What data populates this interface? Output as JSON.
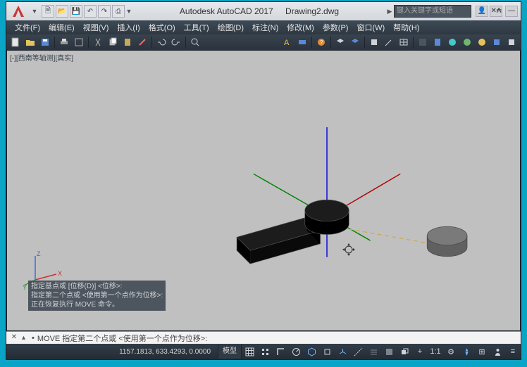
{
  "titlebar": {
    "app_name": "Autodesk AutoCAD 2017",
    "file_name": "Drawing2.dwg",
    "search_placeholder": "键入关键字或短语",
    "qat": [
      "new",
      "open",
      "save",
      "undo",
      "redo",
      "print"
    ]
  },
  "menu": {
    "file": "文件(F)",
    "edit": "编辑(E)",
    "view": "视图(V)",
    "insert": "插入(I)",
    "format": "格式(O)",
    "tools": "工具(T)",
    "draw": "绘图(D)",
    "dimension": "标注(N)",
    "modify": "修改(M)",
    "parametric": "参数(P)",
    "window": "窗口(W)",
    "help": "帮助(H)"
  },
  "viewport": {
    "label": "[-][西南等轴测][真实]",
    "ucs": {
      "x": "X",
      "y": "Y",
      "z": "Z"
    }
  },
  "command_history": {
    "line1": "指定基点或  [位移(D)] <位移>:",
    "line2": "指定第二个点或 <使用第一个点作为位移>:",
    "line3": "正在恢复执行 MOVE 命令。"
  },
  "command_line": {
    "prompt": "MOVE 指定第二个点或 <使用第一个点作为位移>:",
    "bullet": "•"
  },
  "statusbar": {
    "coords": "1157.1813, 633.4293, 0.0000",
    "model": "模型"
  }
}
